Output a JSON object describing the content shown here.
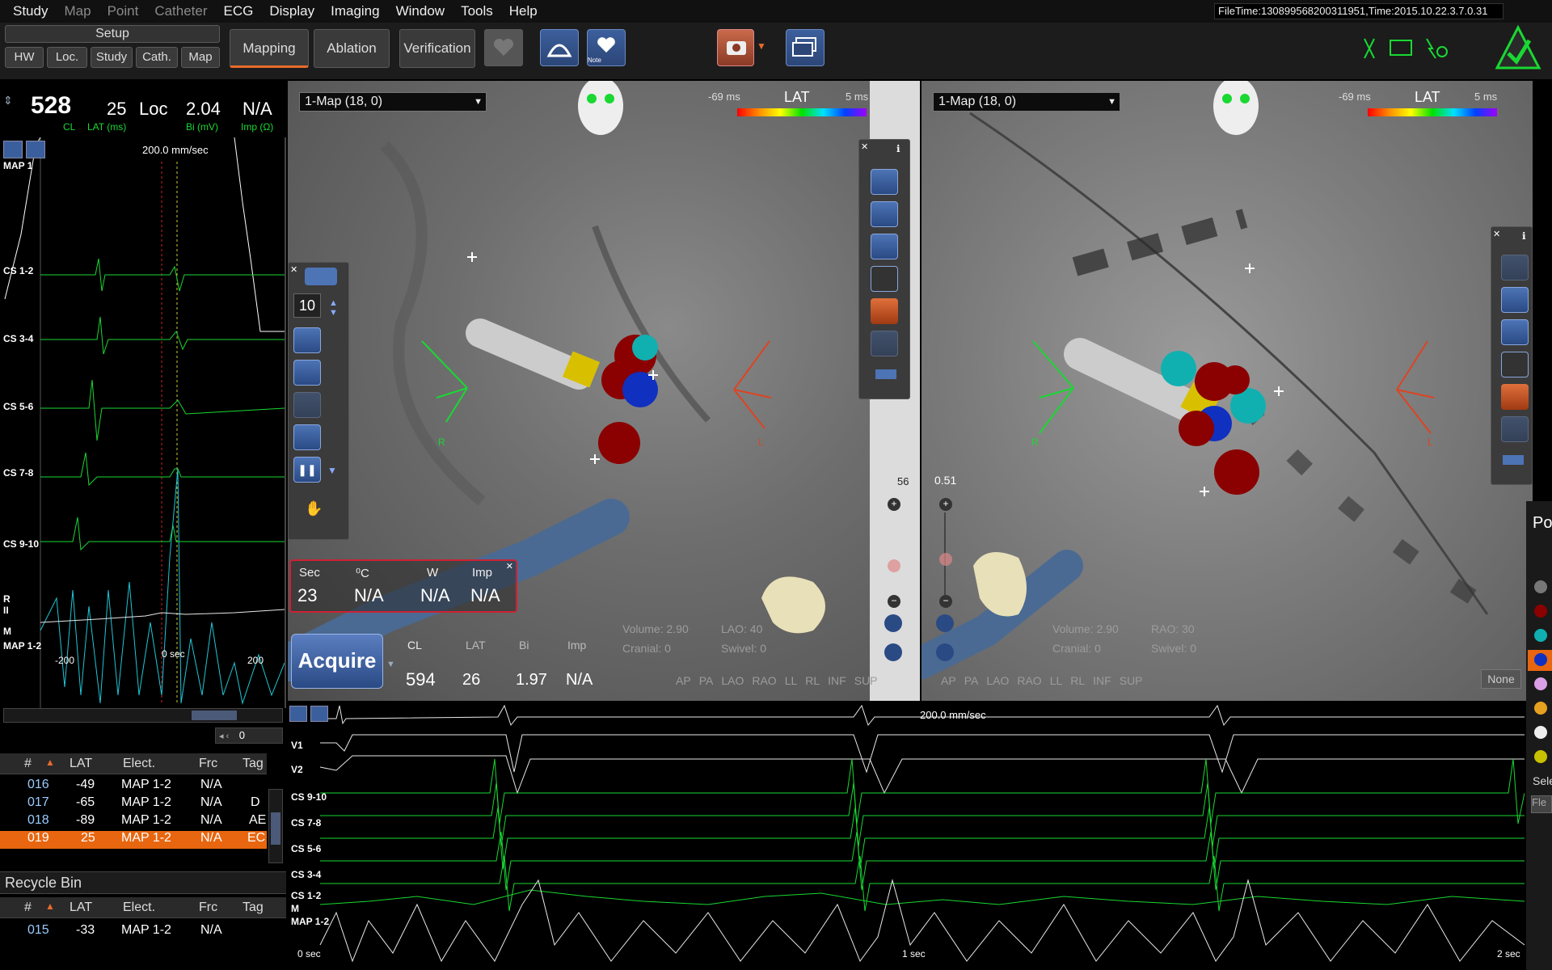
{
  "menu": [
    "Study",
    "Map",
    "Point",
    "Catheter",
    "ECG",
    "Display",
    "Imaging",
    "Window",
    "Tools",
    "Help"
  ],
  "file_time": "FileTime:130899568200311951,Time:2015.10.22.3.7.0.31",
  "toolbar": {
    "setup": "Setup",
    "sub_tabs": [
      "HW",
      "Loc.",
      "Study",
      "Cath.",
      "Map"
    ],
    "mapping": "Mapping",
    "ablation": "Ablation",
    "verification": "Verification",
    "note_label": "Note"
  },
  "status": {
    "cl_value": "528",
    "cl_label": "CL",
    "lat_value": "25",
    "lat_label": "LAT (ms)",
    "loc": "Loc",
    "bi_value": "2.04",
    "bi_label": "Bi (mV)",
    "imp_value": "N/A",
    "imp_label": "Imp (Ω)"
  },
  "left_ecg": {
    "speed": "200.0 mm/sec",
    "channels": [
      "MAP 1",
      "CS 1-2",
      "CS 3-4",
      "CS 5-6",
      "CS 7-8",
      "CS 9-10",
      "R",
      "II",
      "M",
      "MAP 1-2"
    ],
    "axis": [
      "-200",
      "0 sec",
      "200"
    ],
    "page": "0"
  },
  "viewL": {
    "map": "1-Map (18, 0)",
    "lat_label": "LAT",
    "lat_min": "-69 ms",
    "lat_max": "5 ms",
    "speed_value": "10",
    "R": "R",
    "L": "L",
    "side_value": "56",
    "volume": "Volume:",
    "volume_val": "2.90",
    "lao": "LAO:",
    "lao_val": "40",
    "cranial": "Cranial:",
    "cranial_val": "0",
    "swivel": "Swivel:",
    "swivel_val": "0",
    "views": [
      "AP",
      "PA",
      "LAO",
      "RAO",
      "LL",
      "RL",
      "INF",
      "SUP"
    ]
  },
  "viewR": {
    "map": "1-Map (18, 0)",
    "lat_label": "LAT",
    "lat_min": "-69 ms",
    "lat_max": "5 ms",
    "zoom": "0.51",
    "R": "R",
    "L": "L",
    "volume": "Volume:",
    "volume_val": "2.90",
    "rao": "RAO:",
    "rao_val": "30",
    "cranial": "Cranial:",
    "cranial_val": "0",
    "swivel": "Swivel:",
    "swivel_val": "0",
    "views": [
      "AP",
      "PA",
      "LAO",
      "RAO",
      "LL",
      "RL",
      "INF",
      "SUP"
    ],
    "none": "None"
  },
  "ablation": {
    "h_sec": "Sec",
    "h_c": "⁰C",
    "h_w": "W",
    "h_imp": "Imp",
    "v_sec": "23",
    "v_c": "N/A",
    "v_w": "N/A",
    "v_imp": "N/A"
  },
  "acquire": {
    "label": "Acquire",
    "h_cl": "CL",
    "h_lat": "LAT",
    "h_bi": "Bi",
    "h_imp": "Imp",
    "v_cl": "594",
    "v_lat": "26",
    "v_bi": "1.97",
    "v_imp": "N/A"
  },
  "bottom_ecg": {
    "speed": "200.0 mm/sec",
    "channels": [
      "V1",
      "V2",
      "CS 9-10",
      "CS 7-8",
      "CS 5-6",
      "CS 3-4",
      "CS 1-2",
      "M",
      "MAP 1-2"
    ],
    "axis": [
      "0 sec",
      "1 sec",
      "2 sec"
    ]
  },
  "points_table": {
    "headers": [
      "#",
      "LAT",
      "Elect.",
      "Frc",
      "Tag"
    ],
    "rows": [
      {
        "id": "016",
        "lat": "-49",
        "elect": "MAP 1-2",
        "frc": "N/A",
        "tag": ""
      },
      {
        "id": "017",
        "lat": "-65",
        "elect": "MAP 1-2",
        "frc": "N/A",
        "tag": "D"
      },
      {
        "id": "018",
        "lat": "-89",
        "elect": "MAP 1-2",
        "frc": "N/A",
        "tag": "AE"
      },
      {
        "id": "019",
        "lat": "25",
        "elect": "MAP 1-2",
        "frc": "N/A",
        "tag": "EC"
      }
    ]
  },
  "recycle": {
    "title": "Recycle Bin",
    "headers": [
      "#",
      "LAT",
      "Elect.",
      "Frc",
      "Tag"
    ],
    "rows": [
      {
        "id": "015",
        "lat": "-33",
        "elect": "MAP 1-2",
        "frc": "N/A",
        "tag": ""
      }
    ]
  },
  "right_panel": {
    "title": "Po",
    "sel": "Sele",
    "field": "Fle"
  },
  "colors": {
    "ecg_green": "#19d832",
    "ecg_cyan": "#1fc6d6",
    "ecg_white": "#e8e8e8",
    "selected_row": "#e8660f",
    "accent_blue": "#3c5f9c"
  }
}
